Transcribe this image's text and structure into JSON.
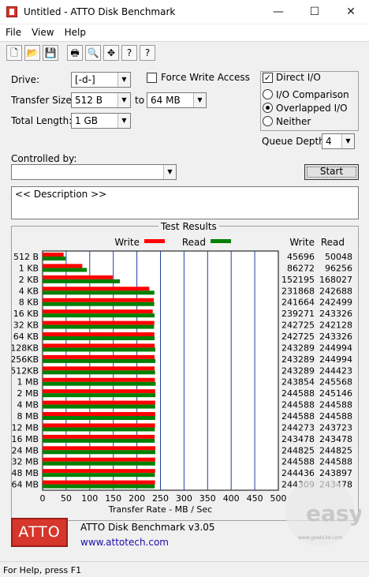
{
  "window": {
    "title": "Untitled - ATTO Disk Benchmark",
    "min": "—",
    "max": "☐",
    "close": "✕"
  },
  "menu": [
    "File",
    "View",
    "Help"
  ],
  "toolbar": [
    {
      "icon": "new-file-icon",
      "glyph": "🗋"
    },
    {
      "icon": "open-folder-icon",
      "glyph": "📂"
    },
    {
      "icon": "save-icon",
      "glyph": "💾"
    },
    {
      "icon": "print-icon",
      "glyph": "🖶"
    },
    {
      "icon": "print-preview-icon",
      "glyph": "🔍"
    },
    {
      "icon": "move-icon",
      "glyph": "✥"
    },
    {
      "icon": "help-icon",
      "glyph": "?"
    },
    {
      "icon": "context-help-icon",
      "glyph": "?"
    }
  ],
  "form": {
    "drive_label": "Drive:",
    "drive_value": "[-d-]",
    "transfer_label": "Transfer Size:",
    "transfer_from": "512 B",
    "to_label": "to",
    "transfer_to": "64 MB",
    "total_label": "Total Length:",
    "total_value": "1 GB",
    "force_write_label": "Force Write Access",
    "direct_io_label": "Direct I/O",
    "io_comparison_label": "I/O Comparison",
    "overlapped_io_label": "Overlapped I/O",
    "neither_label": "Neither",
    "queue_depth_label": "Queue Depth:",
    "queue_depth_value": "4",
    "controlled_by_label": "Controlled by:",
    "controlled_by_value": "",
    "start_label": "Start",
    "description": "<< Description >>"
  },
  "results": {
    "caption": "Test Results",
    "legend_write": "Write",
    "legend_read": "Read",
    "col_write": "Write",
    "col_read": "Read",
    "xlabel": "Transfer Rate - MB / Sec",
    "write_color": "#ff0000",
    "read_color": "#008000"
  },
  "chart_data": {
    "type": "bar",
    "categories": [
      "512 B",
      "1 KB",
      "2 KB",
      "4 KB",
      "8 KB",
      "16 KB",
      "32 KB",
      "64 KB",
      "128KB",
      "256KB",
      "512KB",
      "1 MB",
      "2 MB",
      "4 MB",
      "8 MB",
      "12 MB",
      "16 MB",
      "24 MB",
      "32 MB",
      "48 MB",
      "64 MB"
    ],
    "series": [
      {
        "name": "Write",
        "values": [
          45696,
          86272,
          152195,
          231868,
          241664,
          239271,
          242725,
          242725,
          243289,
          243289,
          243289,
          243854,
          244588,
          244588,
          244588,
          244273,
          243478,
          244825,
          244588,
          244436,
          244309
        ]
      },
      {
        "name": "Read",
        "values": [
          50048,
          96256,
          168027,
          242688,
          242499,
          243326,
          242128,
          243326,
          244994,
          244994,
          244423,
          245568,
          245146,
          244588,
          244588,
          243723,
          243478,
          244825,
          244588,
          243897,
          243478
        ]
      }
    ],
    "xlabel": "Transfer Rate - MB / Sec",
    "xticks": [
      "0",
      "50",
      "100",
      "150",
      "200",
      "250",
      "300",
      "350",
      "400",
      "450",
      "500"
    ],
    "xlim": [
      0,
      500
    ]
  },
  "footer": {
    "logo": "ATTO",
    "product": "ATTO Disk Benchmark v3.05",
    "link": "www.attotech.com"
  },
  "status": "For Help, press F1",
  "watermark": {
    "brand": "easy",
    "site": "www.geeks3d.com"
  }
}
